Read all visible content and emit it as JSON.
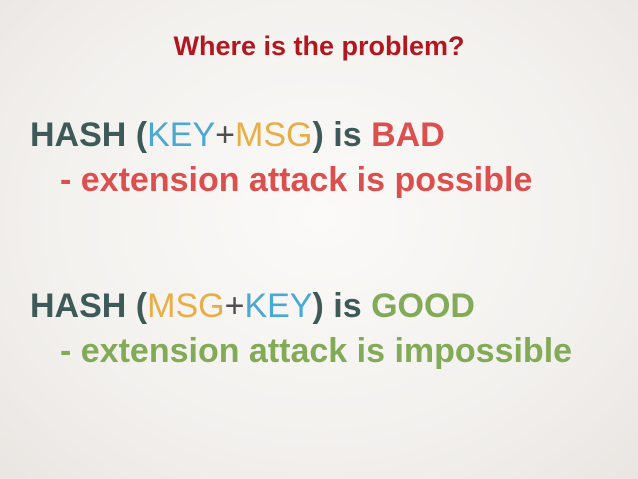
{
  "colors": {
    "title": "#b2161e",
    "dark": "#3d5a59",
    "key": "#4aa8d5",
    "msg": "#e8ae45",
    "bad": "#db4f4f",
    "good": "#83aa56",
    "plus": "#4e4e4e"
  },
  "title": "Where is the problem?",
  "bad_block": {
    "hash": "HASH",
    "open_paren": "(",
    "first": "KEY",
    "plus": "+",
    "second": "MSG",
    "close_paren": ")",
    "is": "is",
    "verdict": "BAD",
    "note": "- extension attack is possible"
  },
  "good_block": {
    "hash": "HASH",
    "open_paren": "(",
    "first": "MSG",
    "plus": "+",
    "second": "KEY",
    "close_paren": ")",
    "is": "is",
    "verdict": "GOOD",
    "note": "- extension attack is impossible"
  }
}
